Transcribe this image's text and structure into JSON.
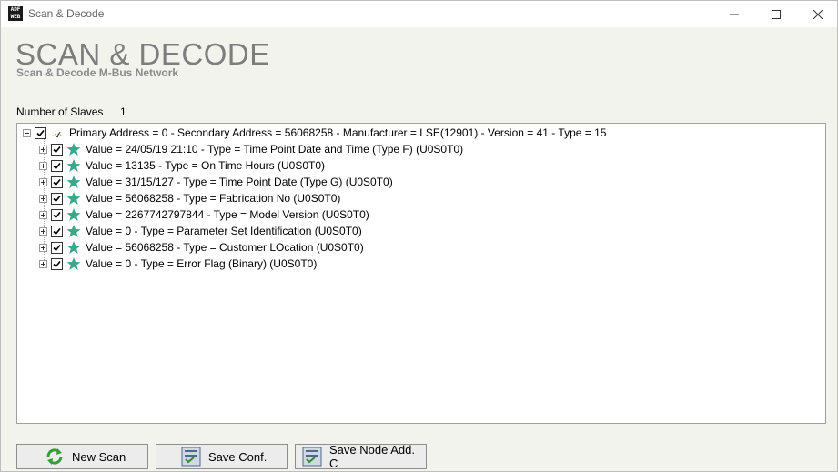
{
  "window": {
    "title": "Scan & Decode",
    "app_icon_text": "ADFWEB"
  },
  "header": {
    "title": "SCAN & DECODE",
    "subtitle": "Scan & Decode M-Bus Network"
  },
  "slaves": {
    "label": "Number of Slaves",
    "count": "1"
  },
  "tree": {
    "root": {
      "label": "Primary Address = 0 - Secondary Address = 56068258 - Manufacturer = LSE(12901) - Version = 41 - Type = 15",
      "checked": true,
      "expanded": true,
      "icon": "meter-dial-icon"
    },
    "children": [
      {
        "label": "Value = 24/05/19 21:10 - Type = Time Point Date and Time (Type F) (U0S0T0)",
        "checked": true,
        "icon": "star-icon"
      },
      {
        "label": "Value = 13135 - Type = On Time Hours (U0S0T0)",
        "checked": true,
        "icon": "star-icon"
      },
      {
        "label": "Value = 31/15/127 - Type = Time Point Date (Type G) (U0S0T0)",
        "checked": true,
        "icon": "star-icon"
      },
      {
        "label": "Value = 56068258 - Type = Fabrication No (U0S0T0)",
        "checked": true,
        "icon": "star-icon"
      },
      {
        "label": "Value = 2267742797844 - Type = Model Version (U0S0T0)",
        "checked": true,
        "icon": "star-icon"
      },
      {
        "label": "Value = 0 - Type = Parameter Set Identification (U0S0T0)",
        "checked": true,
        "icon": "star-icon"
      },
      {
        "label": "Value = 56068258 - Type = Customer LOcation (U0S0T0)",
        "checked": true,
        "icon": "star-icon"
      },
      {
        "label": "Value = 0 - Type = Error Flag (Binary) (U0S0T0)",
        "checked": true,
        "icon": "star-icon"
      }
    ]
  },
  "buttons": {
    "new_scan": "New Scan",
    "save_conf": "Save Conf.",
    "save_node": "Save Node Add. C"
  },
  "colors": {
    "star": "#3aa68a",
    "heading": "#7d7d7d",
    "background": "#f3f3ee"
  }
}
